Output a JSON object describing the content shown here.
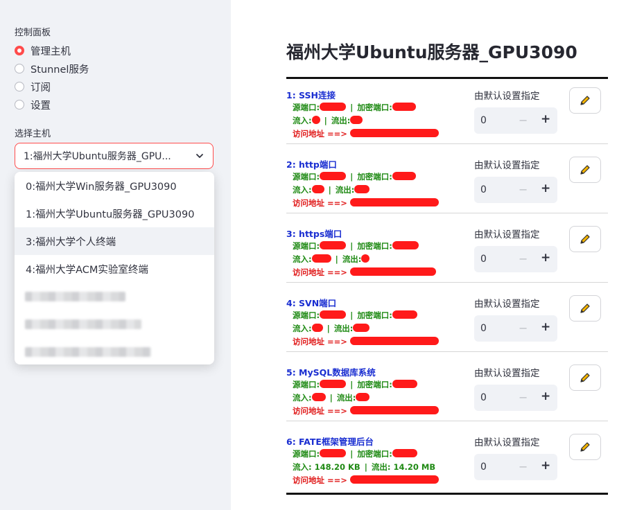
{
  "sidebar": {
    "control_label": "控制面板",
    "nav": [
      {
        "label": "管理主机",
        "selected": true
      },
      {
        "label": "Stunnel服务",
        "selected": false
      },
      {
        "label": "订阅",
        "selected": false
      },
      {
        "label": "设置",
        "selected": false
      }
    ],
    "select_label": "选择主机",
    "selected_host": "1:福州大学Ubuntu服务器_GPU...",
    "options": [
      "0:福州大学Win服务器_GPU3090",
      "1:福州大学Ubuntu服务器_GPU3090",
      "3:福州大学个人终端",
      "4:福州大学ACM实验室终端"
    ]
  },
  "main": {
    "title": "福州大学Ubuntu服务器_GPU3090",
    "source_port_label": "源端口:",
    "encrypted_port_label": "加密端口:",
    "inflow_label": "流入:",
    "outflow_label": "流出:",
    "access_label": "访问地址",
    "arrow": "==>",
    "separator": "|",
    "default_label": "由默认设置指定",
    "stepper_value": "0",
    "minus": "−",
    "plus": "+",
    "services": [
      {
        "title": "1: SSH连接"
      },
      {
        "title": "2: http端口"
      },
      {
        "title": "3: https端口"
      },
      {
        "title": "4: SVN端口"
      },
      {
        "title": "5: MySQL数据库系统"
      },
      {
        "title": "6: FATE框架管理后台",
        "inflow": "148.20 KB",
        "outflow": "14.20 MB"
      }
    ]
  },
  "colors": {
    "accent": "#ff4b4b",
    "link_blue": "#1a2ed1",
    "green": "#1f8a14",
    "red": "#e01b1b"
  }
}
